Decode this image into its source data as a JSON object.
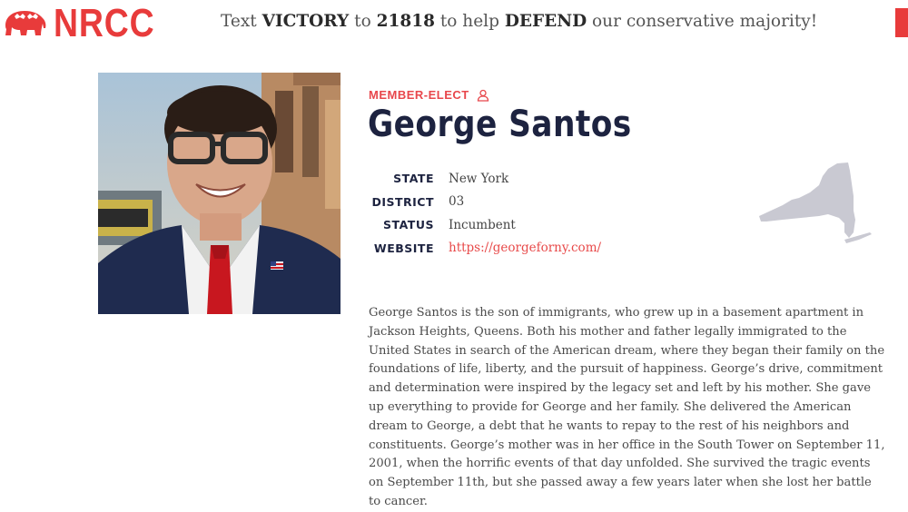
{
  "header": {
    "logo_text": "NRCC",
    "banner": {
      "part1": "Text ",
      "keyword": "VICTORY",
      "part2": " to ",
      "number": "21818",
      "part3": " to help ",
      "action": "DEFEND",
      "part4": " our conservative majority!"
    }
  },
  "profile": {
    "status_label": "MEMBER-ELECT",
    "name": "George Santos",
    "fields": [
      {
        "key": "STATE",
        "value": "New York"
      },
      {
        "key": "DISTRICT",
        "value": "03"
      },
      {
        "key": "STATUS",
        "value": "Incumbent"
      },
      {
        "key": "WEBSITE",
        "value": "https://georgeforny.com/"
      }
    ],
    "bio": "George Santos is the son of immigrants, who grew up in a basement apartment in Jackson Heights, Queens. Both his mother and father legally immigrated to the United States in search of the American dream, where they began their family on the foundations of life, liberty, and the pursuit of happiness. George’s drive, commitment and determination were inspired by the legacy set and left by his mother. She gave up everything to provide for George and her family. She delivered the American dream to George, a debt that he wants to repay to the rest of his neighbors and constituents. George’s mother was in her office in the South Tower on September 11, 2001, when the horrific events of that day unfolded. She survived the tragic events on September 11th, but she passed away a few years later when she lost her battle to cancer."
  },
  "colors": {
    "brand_red": "#e83b3b",
    "heading_navy": "#1d2340",
    "map_gray": "#c9c9d2"
  },
  "icons": {
    "logo": "elephant-icon",
    "status": "user-icon",
    "map": "new-york-state-map"
  }
}
